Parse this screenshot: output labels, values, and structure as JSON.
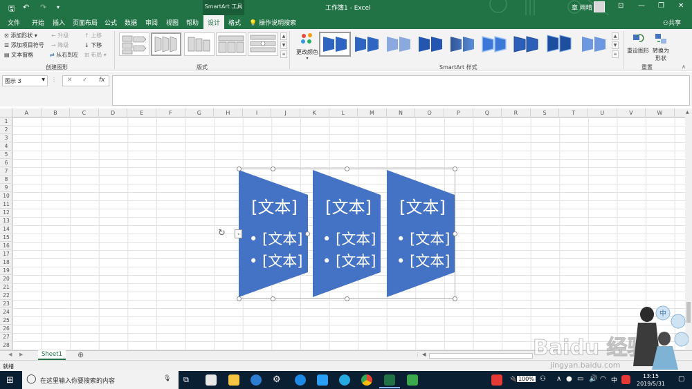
{
  "titlebar": {
    "context_tool": "SmartArt 工具",
    "title": "工作簿1 - Excel",
    "user": "章 雨晴",
    "qa_save": "🖫",
    "qa_undo": "↶",
    "qa_redo": "↷"
  },
  "tabs": [
    "文件",
    "开始",
    "插入",
    "页面布局",
    "公式",
    "数据",
    "审阅",
    "视图",
    "帮助",
    "设计",
    "格式"
  ],
  "active_tab": "设计",
  "tellme": "操作说明搜索",
  "share": "共享",
  "ribbon": {
    "create_graphic": {
      "add_shape": "添加形状",
      "add_bullet": "添加项目符号",
      "text_pane": "文本窗格",
      "promote": "升级",
      "demote": "降级",
      "right_to_left": "从右到左",
      "move_up": "上移",
      "move_down": "下移",
      "layout": "布局",
      "group_label": "创建图形"
    },
    "layouts_label": "版式",
    "change_colors": "更改颜色",
    "styles_label": "SmartArt 样式",
    "reset_graphic": "重设图形",
    "convert": "转换为",
    "convert2": "形状",
    "reset_label": "重置"
  },
  "formula_bar": {
    "name_box": "图示 3",
    "cancel": "✕",
    "enter": "✓",
    "fx": "fx"
  },
  "columns": [
    "A",
    "B",
    "C",
    "D",
    "E",
    "F",
    "G",
    "H",
    "I",
    "J",
    "K",
    "L",
    "M",
    "N",
    "O",
    "P",
    "Q",
    "R",
    "S",
    "T",
    "U",
    "V",
    "W"
  ],
  "rows": [
    "1",
    "2",
    "3",
    "4",
    "5",
    "6",
    "7",
    "8",
    "9",
    "10",
    "11",
    "12",
    "13",
    "14",
    "15",
    "16",
    "17",
    "18",
    "19",
    "20",
    "21",
    "22",
    "23",
    "24",
    "25",
    "26",
    "27",
    "28"
  ],
  "smartart": {
    "fill": "#4472c4",
    "shapes": [
      {
        "title": "[文本]",
        "bullets": [
          "[文本]",
          "[文本]"
        ]
      },
      {
        "title": "[文本]",
        "bullets": [
          "[文本]",
          "[文本]"
        ]
      },
      {
        "title": "[文本]",
        "bullets": [
          "[文本]",
          "[文本]"
        ]
      }
    ]
  },
  "sheet_tab": "Sheet1",
  "status": "就绪",
  "taskbar": {
    "search_placeholder": "在这里输入你要搜索的内容",
    "battery": "100%",
    "ime": "中",
    "time": "13:15",
    "date": "2019/5/31"
  },
  "watermark": "Baidu 经验",
  "watermark_url": "jingyan.baidu.com",
  "colors": {
    "excel_green": "#217346",
    "smartart_blue": "#4472c4"
  }
}
